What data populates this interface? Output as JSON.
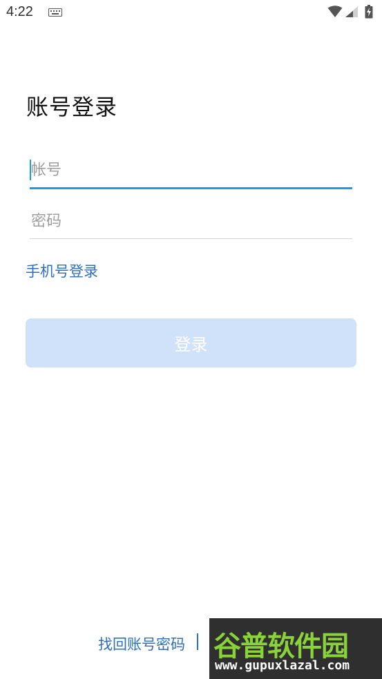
{
  "status_bar": {
    "time": "4:22",
    "icons": [
      "keyboard-icon",
      "wifi-icon",
      "signal-icon",
      "battery-charging-icon"
    ]
  },
  "login": {
    "title": "账号登录",
    "account_placeholder": "帐号",
    "account_value": "",
    "password_placeholder": "密码",
    "password_value": "",
    "phone_login_label": "手机号登录",
    "submit_label": "登录"
  },
  "footer": {
    "find_password_label": "找回账号密码"
  },
  "watermark": {
    "logo_text": "谷普软件园",
    "url_text": "www.gupuxlazal.com"
  },
  "colors": {
    "accent": "#1a9be8",
    "link": "#2d6fbb",
    "button_disabled_bg": "#cfe2f9",
    "divider": "#d4d4d4",
    "watermark_bg": "#2f2f2f",
    "watermark_logo": "#8ad23a"
  }
}
